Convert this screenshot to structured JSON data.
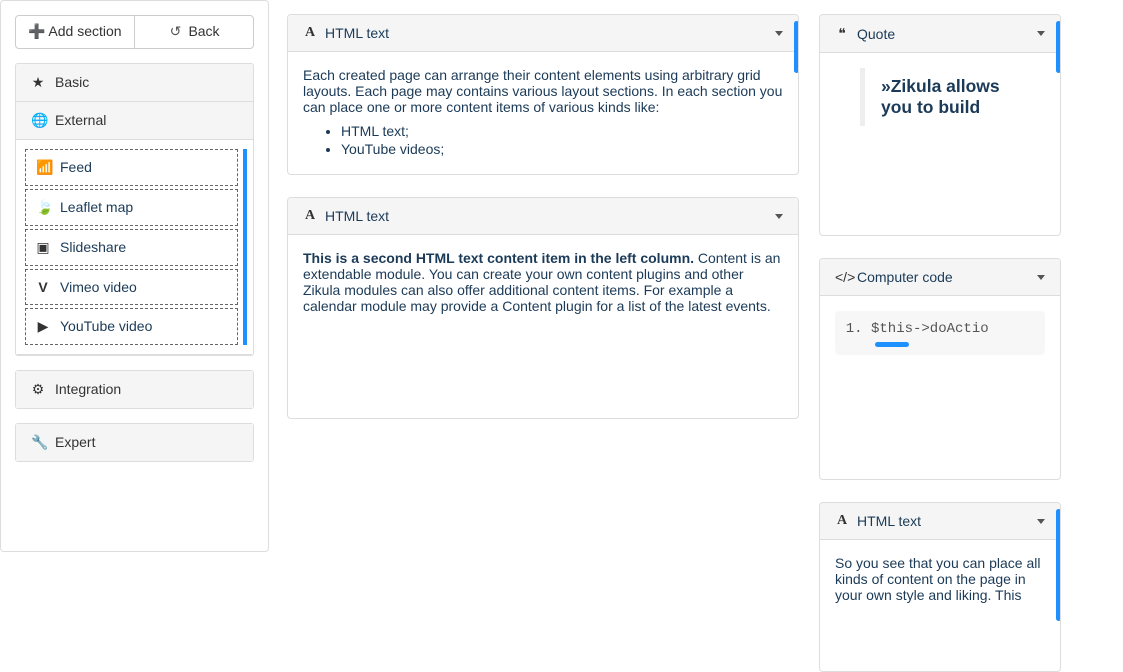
{
  "sidebar": {
    "add_section_label": "Add section",
    "back_label": "Back",
    "groups": {
      "basic": {
        "label": "Basic"
      },
      "external": {
        "label": "External",
        "items": [
          {
            "icon": "rss-icon",
            "label": "Feed"
          },
          {
            "icon": "leaf-icon",
            "label": "Leaflet map"
          },
          {
            "icon": "slideshare-icon",
            "label": "Slideshare"
          },
          {
            "icon": "vimeo-icon",
            "label": "Vimeo video"
          },
          {
            "icon": "youtube-icon",
            "label": "YouTube video"
          }
        ]
      },
      "integration": {
        "label": "Integration"
      },
      "expert": {
        "label": "Expert"
      }
    }
  },
  "content": {
    "left": {
      "html1": {
        "title": "HTML text",
        "body": "Each created page can arrange their content elements using arbitrary grid layouts. Each page may contains various layout sections. In each section you can place one or more content items of various kinds like:",
        "bullets": [
          "HTML text;",
          "YouTube videos;"
        ]
      },
      "html2": {
        "title": "HTML text",
        "lead": "This is a second HTML text content item in the left column.",
        "body": "Content is an extendable module. You can create your own content plugins and other Zikula modules can also offer additional content items. For example a calendar module may provide a Content plugin for a list of the latest events."
      }
    },
    "right": {
      "quote": {
        "title": "Quote",
        "text": "»Zikula allows you to build"
      },
      "code": {
        "title": "Computer code",
        "line1": "$this->doActio"
      },
      "html3": {
        "title": "HTML text",
        "body": "So you see that you can place all kinds of content on the page in your own style and liking. This"
      }
    }
  }
}
